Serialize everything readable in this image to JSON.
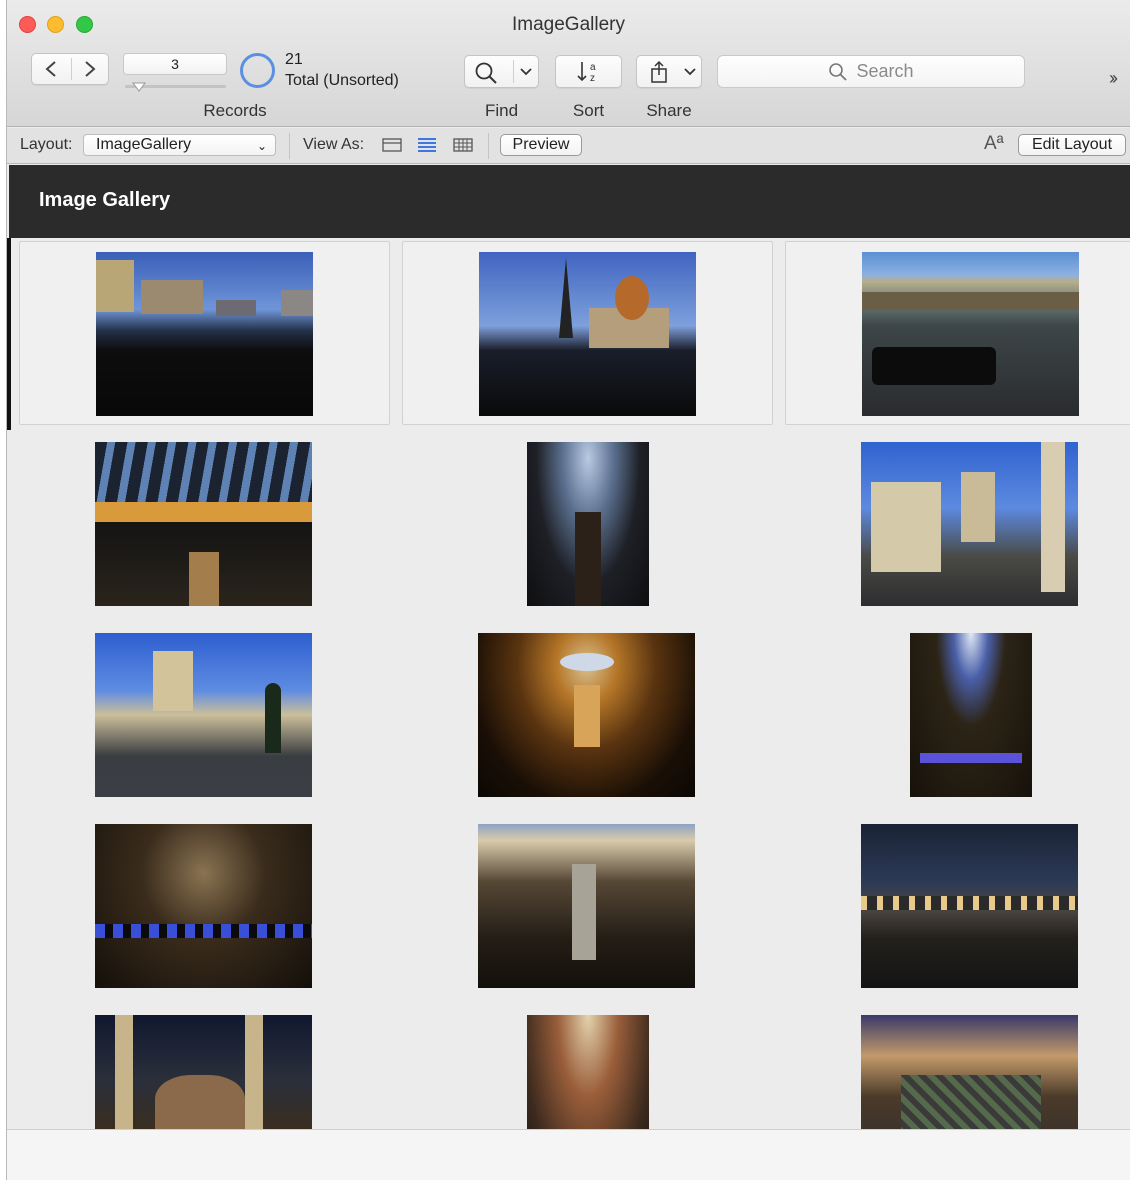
{
  "window": {
    "title": "ImageGallery"
  },
  "toolbar": {
    "record_current": "3",
    "records_label": "Records",
    "total_count": "21",
    "total_label": "Total (Unsorted)",
    "find_label": "Find",
    "sort_label": "Sort",
    "share_label": "Share",
    "search_placeholder": "Search",
    "overflow": "››"
  },
  "layoutbar": {
    "layout_label": "Layout:",
    "layout_value": "ImageGallery",
    "view_as_label": "View As:",
    "preview_label": "Preview",
    "font_size_glyph": "Aª",
    "edit_layout_label": "Edit Layout"
  },
  "header": {
    "title": "Image Gallery"
  },
  "colors": {
    "accent": "#3e77e0",
    "header_bg": "#2b2b2b",
    "window_bg": "#ececec"
  },
  "gallery": {
    "selected_record": 1,
    "photos": [
      {
        "subject": "bellagio-skyline"
      },
      {
        "subject": "eiffel-tower-replica"
      },
      {
        "subject": "limo-porte-cochere"
      },
      {
        "subject": "conservatory-glass-ceiling"
      },
      {
        "subject": "glass-arcade-walkway"
      },
      {
        "subject": "caesars-facade-statues"
      },
      {
        "subject": "caesars-palace-courtyard"
      },
      {
        "subject": "statue-rotunda-lobby"
      },
      {
        "subject": "dome-casino-floor"
      },
      {
        "subject": "forum-shops-entrance"
      },
      {
        "subject": "statue-colonnade"
      },
      {
        "subject": "night-sky-plaza"
      },
      {
        "subject": "fountain-horses-statue"
      },
      {
        "subject": "ornate-hallway"
      },
      {
        "subject": "mall-atrium-floor"
      }
    ]
  }
}
